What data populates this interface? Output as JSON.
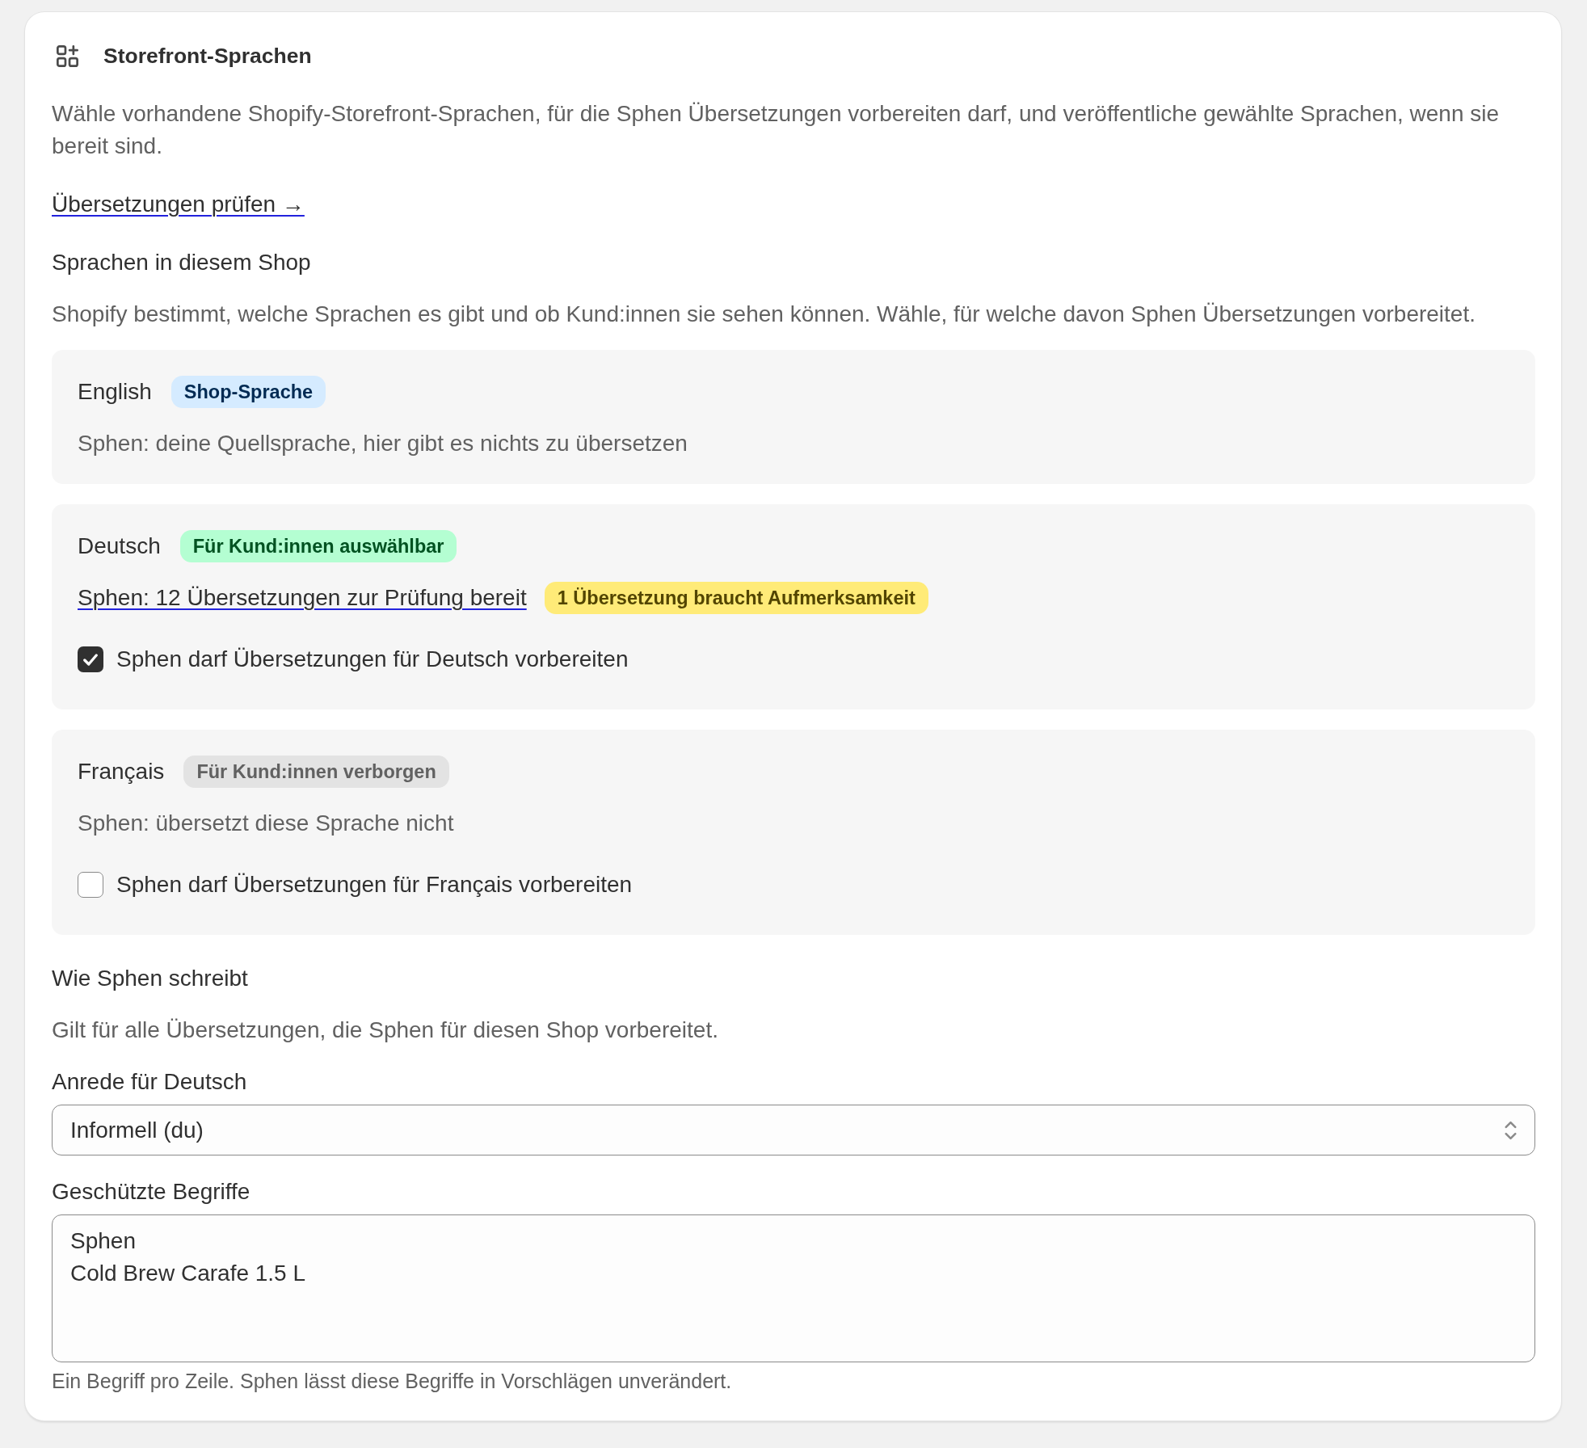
{
  "card": {
    "title": "Storefront-Sprachen",
    "description": "Wähle vorhandene Shopify-Storefront-Sprachen, für die Sphen Übersetzungen vorbereiten darf, und veröffentliche gewählte Sprachen, wenn sie bereit sind.",
    "link": "Übersetzungen prüfen →"
  },
  "languages_section": {
    "heading": "Sprachen in diesem Shop",
    "description": "Shopify bestimmt, welche Sprachen es gibt und ob Kund:innen sie sehen können. Wähle, für welche davon Sphen Übersetzungen vorbereitet."
  },
  "languages": [
    {
      "name": "English",
      "badge": {
        "label": "Shop-Sprache",
        "color": "#d5ebff"
      },
      "status": {
        "kind": "text",
        "text": "Sphen: deine Quellsprache, hier gibt es nichts zu übersetzen"
      }
    },
    {
      "name": "Deutsch",
      "badge": {
        "label": "Für Kund:innen auswählbar",
        "color": "#b4fed2"
      },
      "status": {
        "kind": "link",
        "text": "Sphen: 12 Übersetzungen zur Prüfung bereit"
      },
      "alert": {
        "label": "1 Übersetzung braucht Aufmerksamkeit",
        "color": "#ffeb78"
      },
      "permission": {
        "label": "Sphen darf Übersetzungen für Deutsch vorbereiten",
        "checked": true
      }
    },
    {
      "name": "Français",
      "badge": {
        "label": "Für Kund:innen verborgen",
        "color": "#e3e3e3"
      },
      "status": {
        "kind": "text",
        "text": "Sphen: übersetzt diese Sprache nicht"
      },
      "permission": {
        "label": "Sphen darf Übersetzungen für Français vorbereiten",
        "checked": false
      }
    }
  ],
  "writing_section": {
    "heading": "Wie Sphen schreibt",
    "description": "Gilt für alle Übersetzungen, die Sphen für diesen Shop vorbereitet."
  },
  "form_of_address": {
    "label": "Anrede für Deutsch",
    "value": "Informell (du)"
  },
  "protected_terms": {
    "label": "Geschützte Begriffe",
    "value": "Sphen\nCold Brew Carafe 1.5 L",
    "help": "Ein Begriff pro Zeile. Sphen lässt diese Begriffe in Vorschlägen unverändert."
  }
}
